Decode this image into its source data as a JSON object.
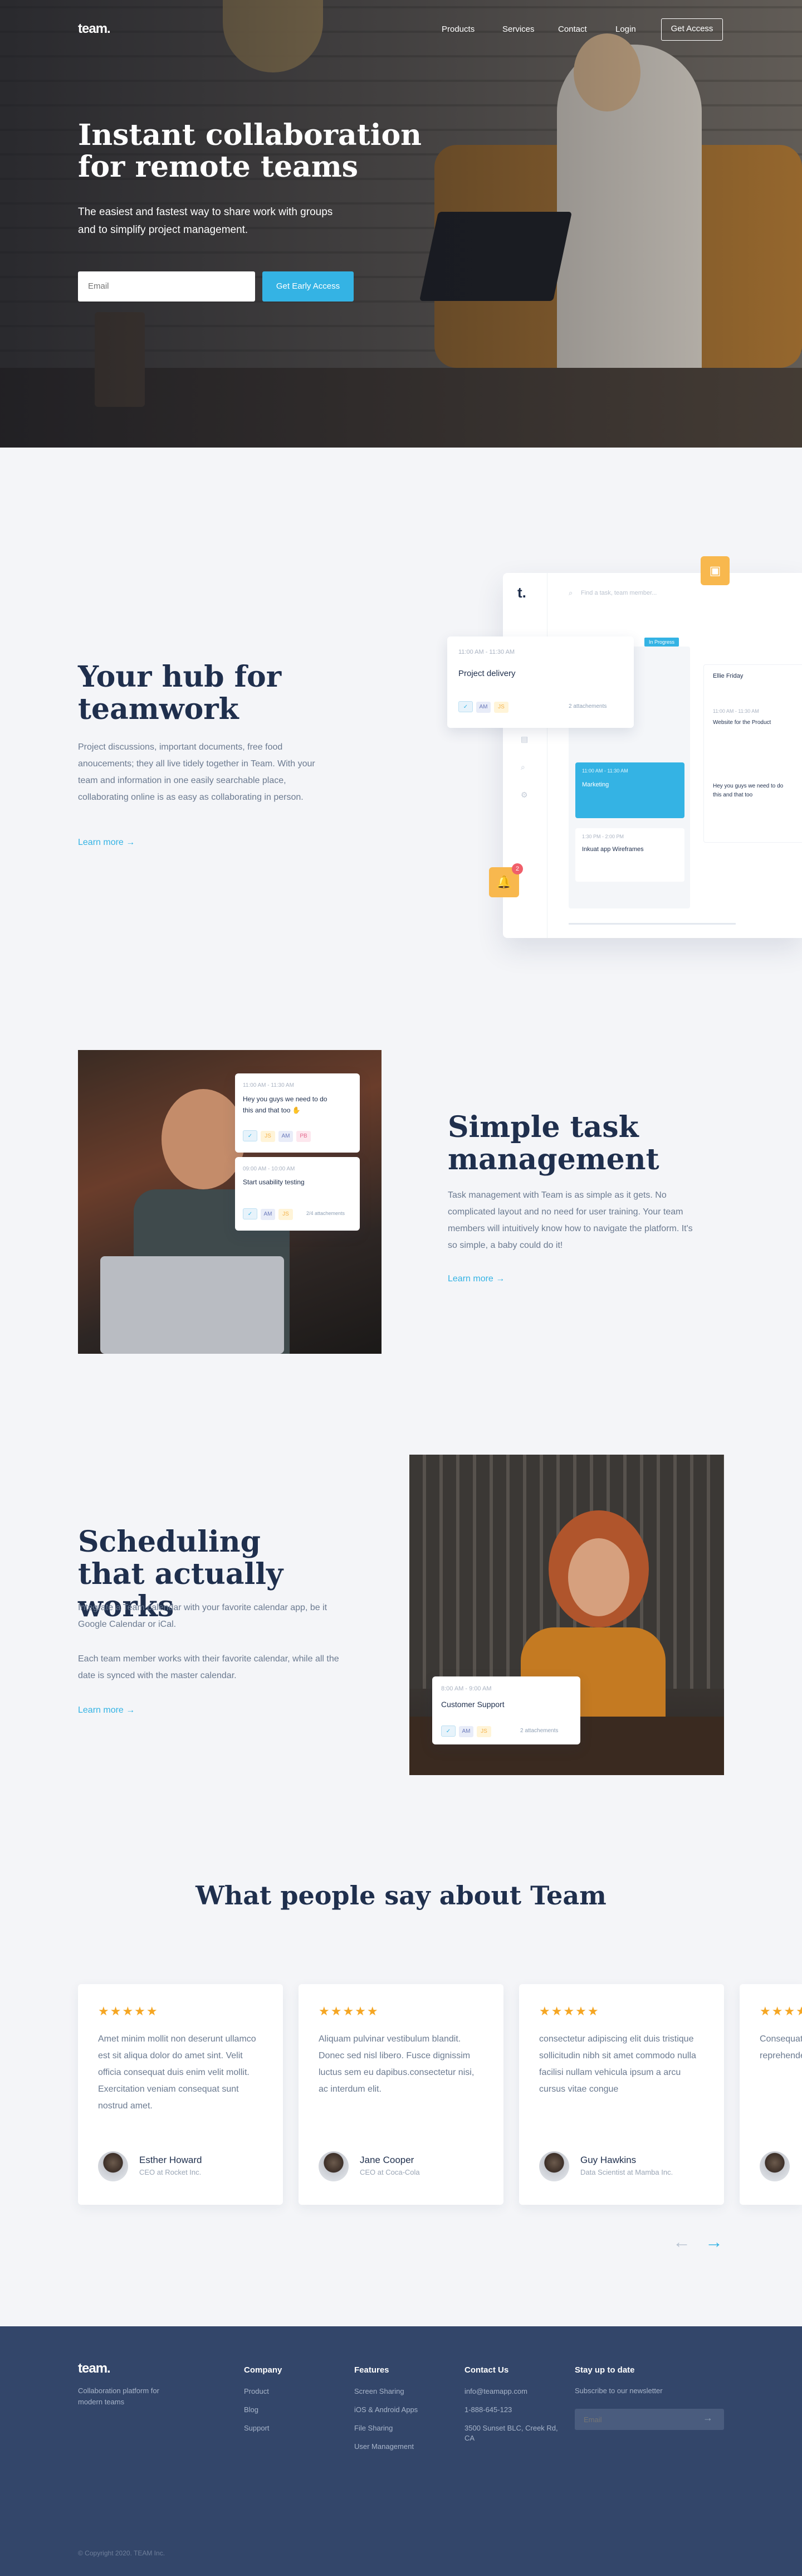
{
  "nav": {
    "logo": "team.",
    "links": [
      "Products",
      "Services",
      "Contact",
      "Login"
    ],
    "cta": "Get Access"
  },
  "hero": {
    "title": "Instant collaboration for remote teams",
    "subtitle": "The easiest and fastest way to share work with groups and to simplify project management.",
    "email_placeholder": "Email",
    "button": "Get Early Access"
  },
  "hub": {
    "title": "Your hub for teamwork",
    "body": "Project discussions, important documents, free food anoucements; they all live tidely together in Team. With your team and information in one easily searchable place, collaborating online is as easy as collaborating in person.",
    "link": "Learn more  →",
    "mock": {
      "logo": "t.",
      "search": "Find a task, team member...",
      "card_time": "11:00 AM - 11:30 AM",
      "card_title": "Project delivery",
      "card_attach": "2 attachements",
      "col_label": "In Progress",
      "task1_time": "11:00 AM - 11:30 AM",
      "task1_title": "Marketing",
      "task2_time": "1:30 PM - 2:00 PM",
      "task2_title": "Inkuat app Wireframes",
      "col2_title": "Ellie Friday",
      "col2_time": "11:00 AM - 11:30 AM",
      "col2_task": "Website for the Product",
      "col2_msg": "Hey you guys we need to do this and that too",
      "badge": "2"
    }
  },
  "task": {
    "title": "Simple task management",
    "body": "Task management with Team is as simple as it gets. No complicated layout and no need for user training. Your team members will intuitively know how to navigate the platform. It's so simple, a baby could do it!",
    "link": "Learn more  →",
    "card1_time": "11:00 AM - 11:30 AM",
    "card1_text": "Hey you guys we need to do this and that too ✋",
    "card2_time": "09:00 AM - 10:00 AM",
    "card2_text": "Start usability testing",
    "card2_attach": "2/4 attachements"
  },
  "schedule": {
    "title": "Scheduling that actually works",
    "body1": "Integrate a Team calendar with your favorite calendar app, be it Google Calendar or iCal.",
    "body2": "Each team member works with their favorite calendar, while all the date is synced with the master calendar.",
    "link": "Learn more  →",
    "card_time": "8:00 AM - 9:00 AM",
    "card_title": "Customer Support",
    "card_attach": "2 attachements"
  },
  "reviews": {
    "title": "What people say about Team",
    "stars": "★★★★★",
    "items": [
      {
        "quote": "Amet minim mollit non deserunt ullamco est sit aliqua dolor do amet sint. Velit officia consequat duis enim velit mollit. Exercitation veniam consequat sunt nostrud amet.",
        "name": "Esther Howard",
        "role": "CEO at Rocket Inc."
      },
      {
        "quote": "Aliquam pulvinar vestibulum blandit. Donec sed nisl libero. Fusce dignissim luctus sem eu dapibus.consectetur nisi, ac interdum elit.",
        "name": "Jane Cooper",
        "role": "CEO at Coca-Cola"
      },
      {
        "quote": "consectetur adipiscing elit duis tristique sollicitudin nibh sit amet commodo nulla facilisi nullam vehicula ipsum a arcu cursus vitae congue",
        "name": "Guy Hawkins",
        "role": "Data Scientist at Mamba Inc."
      },
      {
        "quote": "Consequat cillum dolor pariatur. Ex reprehender",
        "name": "",
        "role": ""
      }
    ],
    "prev": "←",
    "next": "→"
  },
  "footer": {
    "logo": "team.",
    "tagline": "Collaboration platform for modern teams",
    "company_title": "Company",
    "company": [
      "Product",
      "Blog",
      "Support"
    ],
    "features_title": "Features",
    "features": [
      "Screen Sharing",
      "iOS & Android Apps",
      "File Sharing",
      "User Management"
    ],
    "contact_title": "Contact Us",
    "contact": [
      "info@teamapp.com",
      "1-888-645-123",
      "3500 Sunset BLC, Creek Rd, CA"
    ],
    "news_title": "Stay up to date",
    "news_sub": "Subscribe to our newsletter",
    "news_placeholder": "Email",
    "copyright": "© Copyright 2020. TEAM Inc."
  },
  "colors": {
    "accent": "#34b3e4",
    "navy": "#33466a",
    "star": "#f5a623"
  }
}
